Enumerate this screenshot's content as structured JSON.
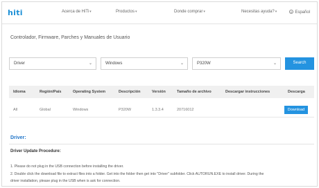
{
  "header": {
    "logo": "hiti",
    "nav": [
      {
        "label": "Acerca de HiTi"
      },
      {
        "label": "Productos"
      },
      {
        "label": "Donde comprar"
      },
      {
        "label": "Necesitas ayuda?"
      }
    ],
    "caret": "▾",
    "language": "Español"
  },
  "page": {
    "title": "Controlador, Firmware, Parches y Manuales de Usuario"
  },
  "filters": {
    "type_value": "Driver",
    "os_value": "Windows",
    "model_value": "P320W",
    "search_label": "Search"
  },
  "table": {
    "headers": [
      "Idioma",
      "Región/País",
      "Operating System",
      "Descripción",
      "Versión",
      "Tamaño de archivo",
      "Descargar instrucciones",
      "Descarga"
    ],
    "rows": [
      {
        "idioma": "All",
        "region": "Global",
        "os": "Windows",
        "descripcion": "P320W",
        "version": "1.3.3.4",
        "tamano": "20716012",
        "instrucciones": "",
        "download_label": "Download"
      }
    ]
  },
  "driver": {
    "title": "Driver:",
    "procedure_title": "Driver Update Procedure:",
    "steps": [
      "1. Please do not plug in the USB connection before installing the driver.",
      "2. Double click the download file to extract files into a folder. Get into the folder then get into \"Driver\" subfolder. Click AUTORUN.EXE to install driver. During the",
      "driver installation, please plug in the USB when is ask for connection."
    ]
  },
  "colors": {
    "accent": "#2493e0",
    "driver_title": "#1f74c8",
    "logo": "#1c8fd6"
  }
}
